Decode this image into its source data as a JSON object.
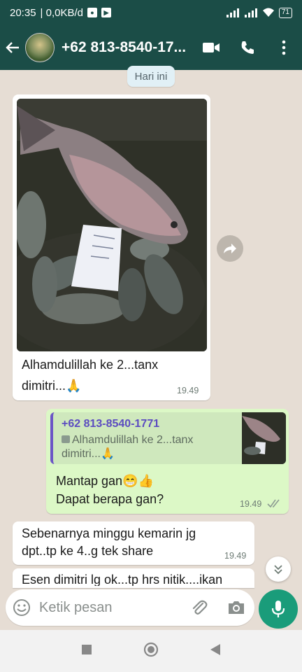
{
  "status_bar": {
    "time": "20:35",
    "data_rate": "| 0,0KB/d",
    "battery": "71"
  },
  "header": {
    "contact": "+62 813-8540-17..."
  },
  "date_chip": "Hari ini",
  "messages": [
    {
      "direction": "in",
      "has_photo": true,
      "text_line1": "Alhamdulillah ke 2...tanx",
      "text_line2": "dimitri...🙏",
      "time": "19.49"
    },
    {
      "direction": "out",
      "reply_to": {
        "name": "+62 813-8540-1771",
        "text_line1": "Alhamdulillah ke 2...tanx",
        "text_line2": "dimitri...🙏"
      },
      "text_line1": "Mantap gan😁👍",
      "text_line2": "Dapat berapa gan?",
      "time": "19.49",
      "status": "read"
    },
    {
      "direction": "in",
      "text_line1": "Sebenarnya minggu kemarin jg",
      "text_line2": "dpt..tp ke 4..g tek share",
      "time": "19.49"
    },
    {
      "direction": "in",
      "text_line1": "Esen dimitri lg ok...tp hrs nitik....ikan",
      "time": ""
    }
  ],
  "composer": {
    "placeholder": "Ketik pesan"
  },
  "colors": {
    "header": "#1b4d47",
    "chat_bg": "#e6ddd4",
    "bubble_in": "#ffffff",
    "bubble_out": "#dcf8c6",
    "mic_button": "#1a9c7a",
    "quote_bar": "#6b55c6"
  }
}
